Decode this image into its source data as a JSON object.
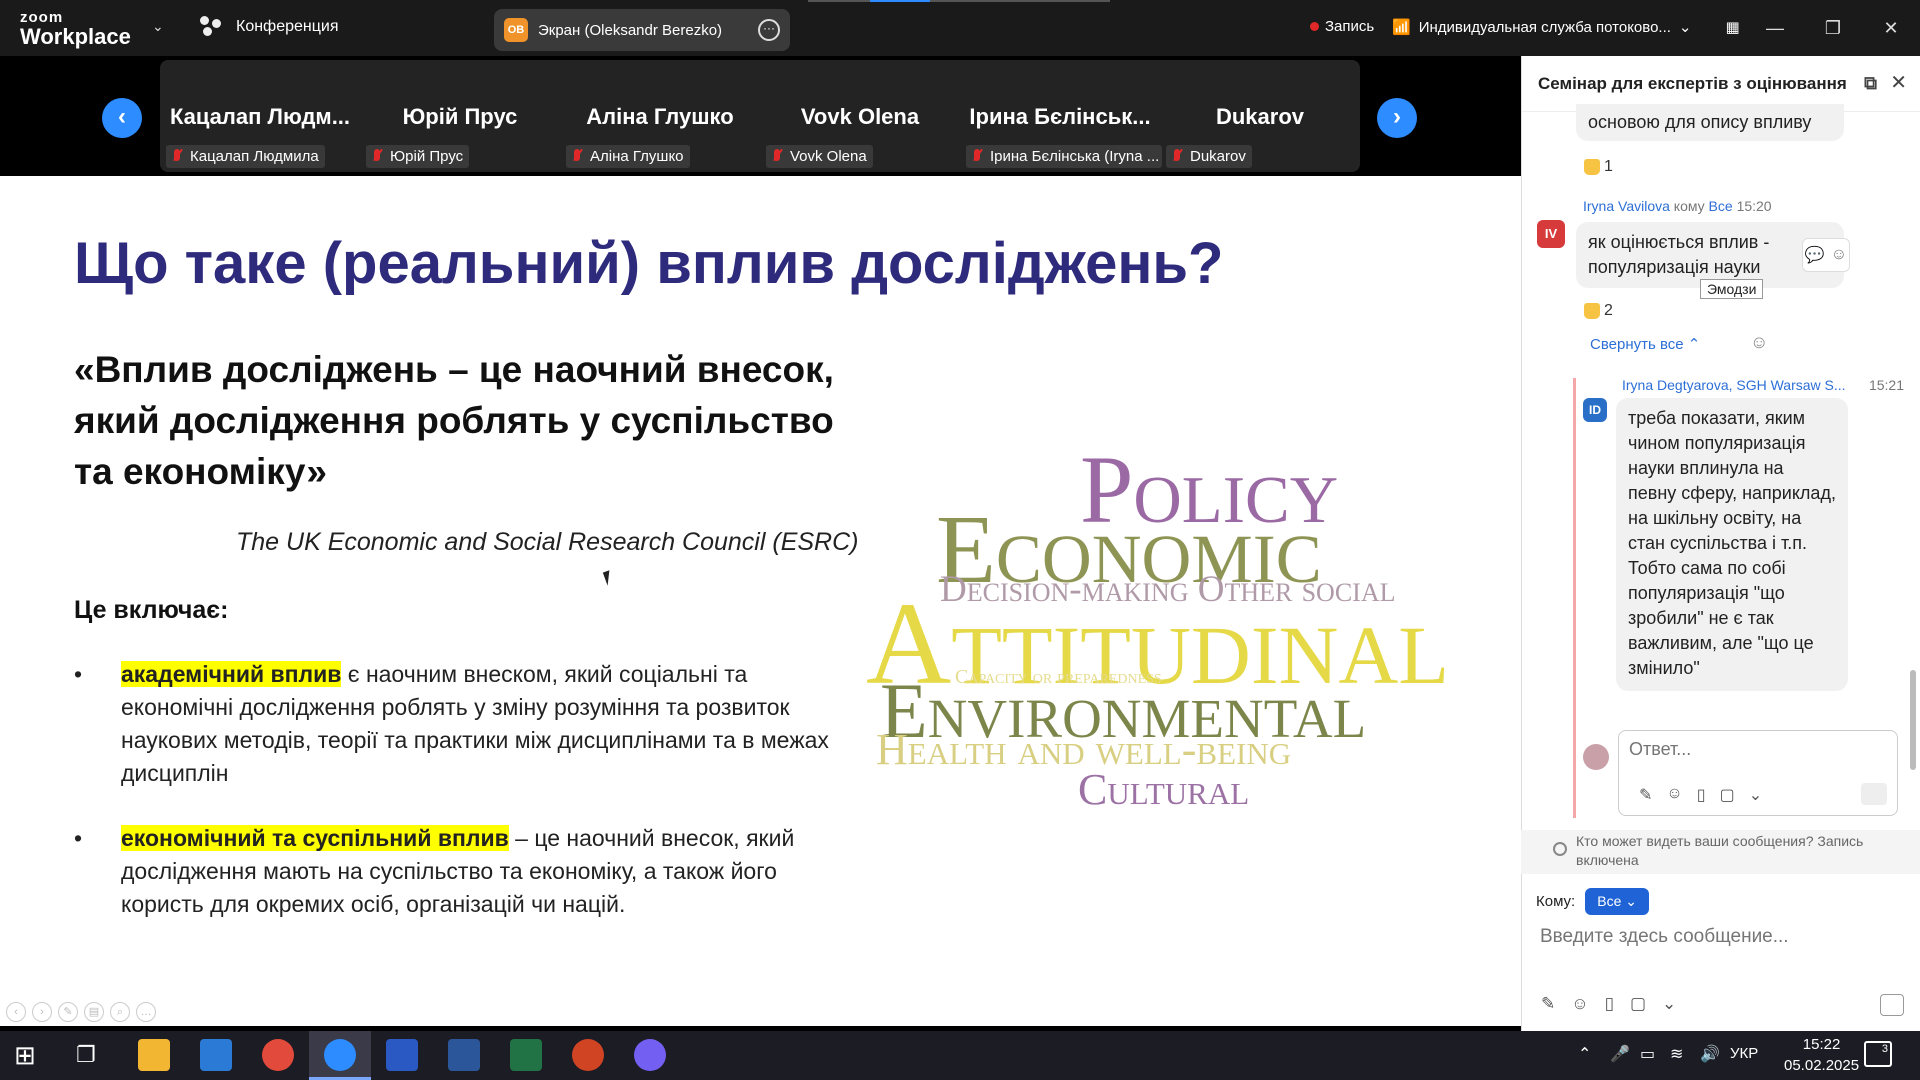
{
  "zoom": {
    "logo_line1": "zoom",
    "logo_line2": "Workplace",
    "meeting_label": "Конференция",
    "share_avatar": "OB",
    "share_label": "Экран (Oleksandr Berezko)",
    "record_label": "Запись",
    "stream_label": "Индивидуальная служба потоково..."
  },
  "participants": [
    {
      "big": "Кацалап  Людм...",
      "small": "Кацалап Людмила"
    },
    {
      "big": "Юрій Прус",
      "small": "Юрій Прус"
    },
    {
      "big": "Аліна Глушко",
      "small": "Аліна Глушко"
    },
    {
      "big": "Vovk Olena",
      "small": "Vovk Olena"
    },
    {
      "big": "Ірина Бєлінськ...",
      "small": "Ірина Бєлінська (Iryna ..."
    },
    {
      "big": "Dukarov",
      "small": "Dukarov"
    }
  ],
  "slide": {
    "title": "Що таке (реальний) вплив досліджень?",
    "quote": "«Вплив досліджень – це наочний внесок, який дослідження роблять у суспільство та економіку»",
    "source": "The UK Economic and Social Research Council (ESRC)",
    "includes": "Це включає:",
    "bullets": [
      {
        "highlight": "академічний вплив",
        "rest": " є наочним внеском, який соціальні та економічні дослідження роблять у зміну розуміння та розвиток наукових методів, теорії та практики між дисциплінами та в межах дисциплін"
      },
      {
        "highlight": "економічний та суспільний вплив",
        "rest": " – це наочний внесок, який дослідження мають на суспільство та економіку, а також його користь для окремих осіб, організацій чи націй."
      }
    ],
    "wordcloud": {
      "policy": "Policy",
      "economic": "Economic",
      "decision": "Decision-making Other social",
      "attitudinal": "Attitudinal",
      "capacity": "Capacity or preparedness",
      "environmental": "Environmental",
      "health": "Health and well-being",
      "cultural": "Cultural"
    }
  },
  "chat": {
    "title": "Семінар для експертів з оцінювання...",
    "msg0_tail": "основою для опису впливу",
    "msg0_react_count": "1",
    "msg1_sender": "Iryna Vavilova",
    "msg1_to": " кому ",
    "msg1_to_all": "Все",
    "msg1_time": "15:20",
    "msg1_avatar": "IV",
    "msg1_text": "як оцінюється вплив - популяризація науки",
    "tooltip": "Эмодзи",
    "msg1_react_count": "2",
    "collapse_label": "Свернуть все",
    "msg2_sender": "Iryna Degtyarova, SGH Warsaw S...",
    "msg2_time": "15:21",
    "msg2_avatar": "ID",
    "msg2_text": "треба показати, яким чином популяризація науки вплинула на певну сферу, наприклад, на шкільну освіту, на стан суспільства і т.п. Тобто сама по собі популяризація \"що зробили\" не є так важливим, але \"що це змінило\"",
    "reply_placeholder": "Ответ...",
    "privacy_text": "Кто может видеть ваши сообщения? Запись включена",
    "to_label": "Кому:",
    "to_value": "Все",
    "message_placeholder": "Введите здесь сообщение..."
  },
  "taskbar": {
    "lang": "УКР",
    "time": "15:22",
    "date": "05.02.2025",
    "notifications": "3"
  }
}
